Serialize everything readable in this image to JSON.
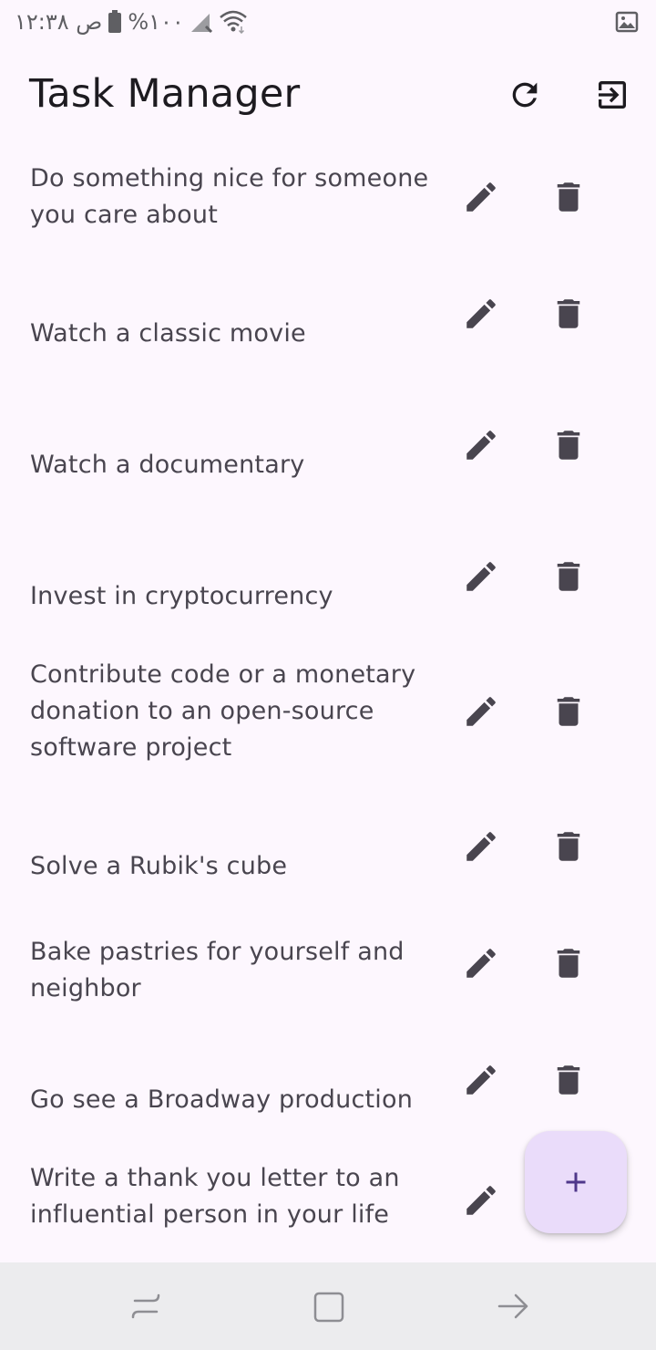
{
  "status_bar": {
    "text": "ص ١٢:٣٨",
    "battery_text": "%١٠٠",
    "icons": [
      "battery-icon",
      "signal-icon",
      "wifi-icon",
      "image-notification-icon"
    ]
  },
  "app_bar": {
    "title": "Task Manager",
    "actions": [
      "refresh-icon",
      "logout-icon"
    ]
  },
  "tasks": [
    {
      "title": "Do something nice for someone you care about"
    },
    {
      "title": "Watch a classic movie"
    },
    {
      "title": "Watch a documentary"
    },
    {
      "title": "Invest in cryptocurrency"
    },
    {
      "title": "Contribute code or a monetary donation to an open-source software project"
    },
    {
      "title": "Solve a Rubik's cube"
    },
    {
      "title": "Bake pastries for yourself and neighbor"
    },
    {
      "title": "Go see a Broadway production"
    },
    {
      "title": "Write a thank you letter to an influential person in your life"
    }
  ],
  "fab": {
    "icon": "plus-icon"
  },
  "nav_bar": {
    "icons": [
      "back-icon",
      "home-icon",
      "recent-apps-icon"
    ]
  },
  "colors": {
    "background": "#fdf7fe",
    "icon": "#49454f",
    "fab_background": "#eadcfa",
    "fab_icon": "#4f378a",
    "nav_background": "#ececee"
  }
}
